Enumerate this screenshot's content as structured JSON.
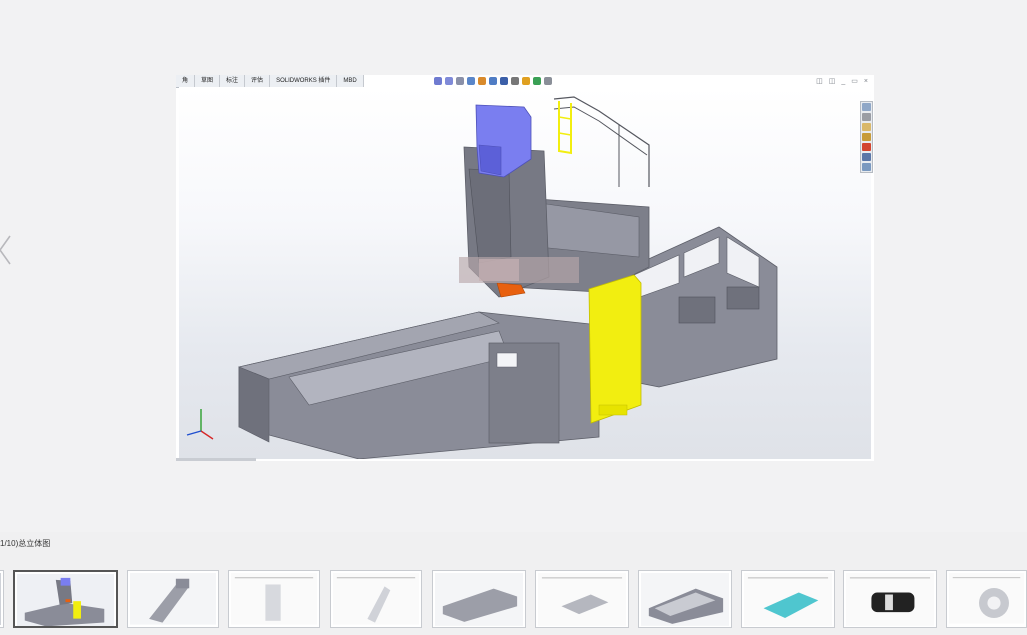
{
  "viewer": {
    "prev_label": "‹",
    "caption": "1/10)总立体图"
  },
  "cad": {
    "tabs": [
      "特征",
      "草图",
      "标注",
      "评估",
      "SOLIDWORKS 插件",
      "MBD"
    ],
    "tab_first_visible": "角",
    "window_controls": [
      "◫",
      "◫",
      "_",
      "▭",
      "×"
    ],
    "taskpane_icons": [
      "home-icon",
      "resources-icon",
      "folder-icon",
      "view-palette-icon",
      "appearance-icon",
      "custom-properties-icon",
      "forum-icon"
    ],
    "colors": {
      "body_gray": "#8a8c98",
      "body_dark": "#6f717c",
      "head_blue": "#7a7ef0",
      "column_yellow": "#f2ee10",
      "tool_orange": "#e8600f"
    },
    "axes": {
      "x": "x",
      "y": "y",
      "z": "z"
    }
  },
  "thumbnails": [
    {
      "name": "thumb-1-machine-assembly",
      "active": false
    },
    {
      "name": "thumb-2-overall-view",
      "active": true
    },
    {
      "name": "thumb-3-spindle-head",
      "active": false
    },
    {
      "name": "thumb-4-column-drawing",
      "active": false
    },
    {
      "name": "thumb-5-bracket-drawing",
      "active": false
    },
    {
      "name": "thumb-6-bed-drawing",
      "active": false
    },
    {
      "name": "thumb-7-plate-drawing",
      "active": false
    },
    {
      "name": "thumb-8-frame-view",
      "active": false
    },
    {
      "name": "thumb-9-cyan-assembly-drawing",
      "active": false
    },
    {
      "name": "thumb-10-drum-drawing",
      "active": false
    },
    {
      "name": "thumb-11-housing-drawing",
      "active": false
    }
  ]
}
